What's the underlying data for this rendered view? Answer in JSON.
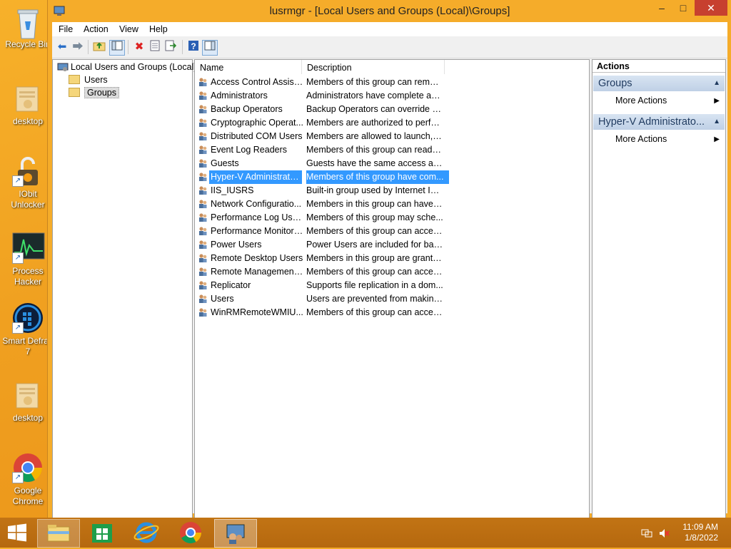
{
  "desktop": {
    "icons": [
      {
        "label": "Recycle Bin",
        "icon": "recycle-bin-icon"
      },
      {
        "label": "desktop",
        "icon": "folder-icon"
      },
      {
        "label": "IObit Unlocker",
        "icon": "lock-icon"
      },
      {
        "label": "Process Hacker",
        "icon": "process-hacker-icon"
      },
      {
        "label": "Smart Defrag 7",
        "icon": "defrag-icon"
      },
      {
        "label": "desktop",
        "icon": "folder-icon"
      },
      {
        "label": "Google Chrome",
        "icon": "chrome-icon"
      }
    ]
  },
  "window": {
    "title": "lusrmgr - [Local Users and Groups (Local)\\Groups]",
    "controls": {
      "minimize": "–",
      "maximize": "□",
      "close": "✕"
    }
  },
  "menubar": [
    "File",
    "Action",
    "View",
    "Help"
  ],
  "toolbar": {
    "buttons": [
      "back-icon",
      "forward-icon",
      "up-folder-icon",
      "show-hide-tree-icon",
      "delete-icon",
      "properties-icon",
      "export-list-icon",
      "help-icon",
      "show-hide-action-pane-icon"
    ]
  },
  "tree": {
    "root": "Local Users and Groups (Local)",
    "children": [
      "Users",
      "Groups"
    ],
    "selected": "Groups"
  },
  "list": {
    "columns": [
      "Name",
      "Description"
    ],
    "rows": [
      {
        "name": "Access Control Assist...",
        "description": "Members of this group can remot..."
      },
      {
        "name": "Administrators",
        "description": "Administrators have complete an..."
      },
      {
        "name": "Backup Operators",
        "description": "Backup Operators can override se..."
      },
      {
        "name": "Cryptographic Operat...",
        "description": "Members are authorized to perfor..."
      },
      {
        "name": "Distributed COM Users",
        "description": "Members are allowed to launch, a..."
      },
      {
        "name": "Event Log Readers",
        "description": "Members of this group can read e..."
      },
      {
        "name": "Guests",
        "description": "Guests have the same access as m..."
      },
      {
        "name": "Hyper-V Administrators",
        "description": "Members of this group have com..."
      },
      {
        "name": "IIS_IUSRS",
        "description": "Built-in group used by Internet Inf..."
      },
      {
        "name": "Network Configuratio...",
        "description": "Members in this group can have s..."
      },
      {
        "name": "Performance Log Users",
        "description": "Members of this group may sche..."
      },
      {
        "name": "Performance Monitor ...",
        "description": "Members of this group can acces..."
      },
      {
        "name": "Power Users",
        "description": "Power Users are included for back..."
      },
      {
        "name": "Remote Desktop Users",
        "description": "Members in this group are grante..."
      },
      {
        "name": "Remote Management...",
        "description": "Members of this group can acces..."
      },
      {
        "name": "Replicator",
        "description": "Supports file replication in a dom..."
      },
      {
        "name": "Users",
        "description": "Users are prevented from making ..."
      },
      {
        "name": "WinRMRemoteWMIU...",
        "description": "Members of this group can acces..."
      }
    ],
    "selected_index": 7
  },
  "actions": {
    "title": "Actions",
    "sections": [
      {
        "header": "Groups",
        "items": [
          "More Actions"
        ]
      },
      {
        "header": "Hyper-V Administrato...",
        "items": [
          "More Actions"
        ]
      }
    ]
  },
  "taskbar": {
    "items": [
      "start-icon",
      "file-explorer-icon",
      "store-icon",
      "internet-explorer-icon",
      "chrome-icon",
      "lusrmgr-icon"
    ],
    "clock": {
      "time": "11:09 AM",
      "date": "1/8/2022"
    }
  },
  "colors": {
    "selection": "#3399ff",
    "window_frame": "#f5ac2a",
    "close_button": "#c7402f",
    "actions_header": "#bfd0e6"
  }
}
